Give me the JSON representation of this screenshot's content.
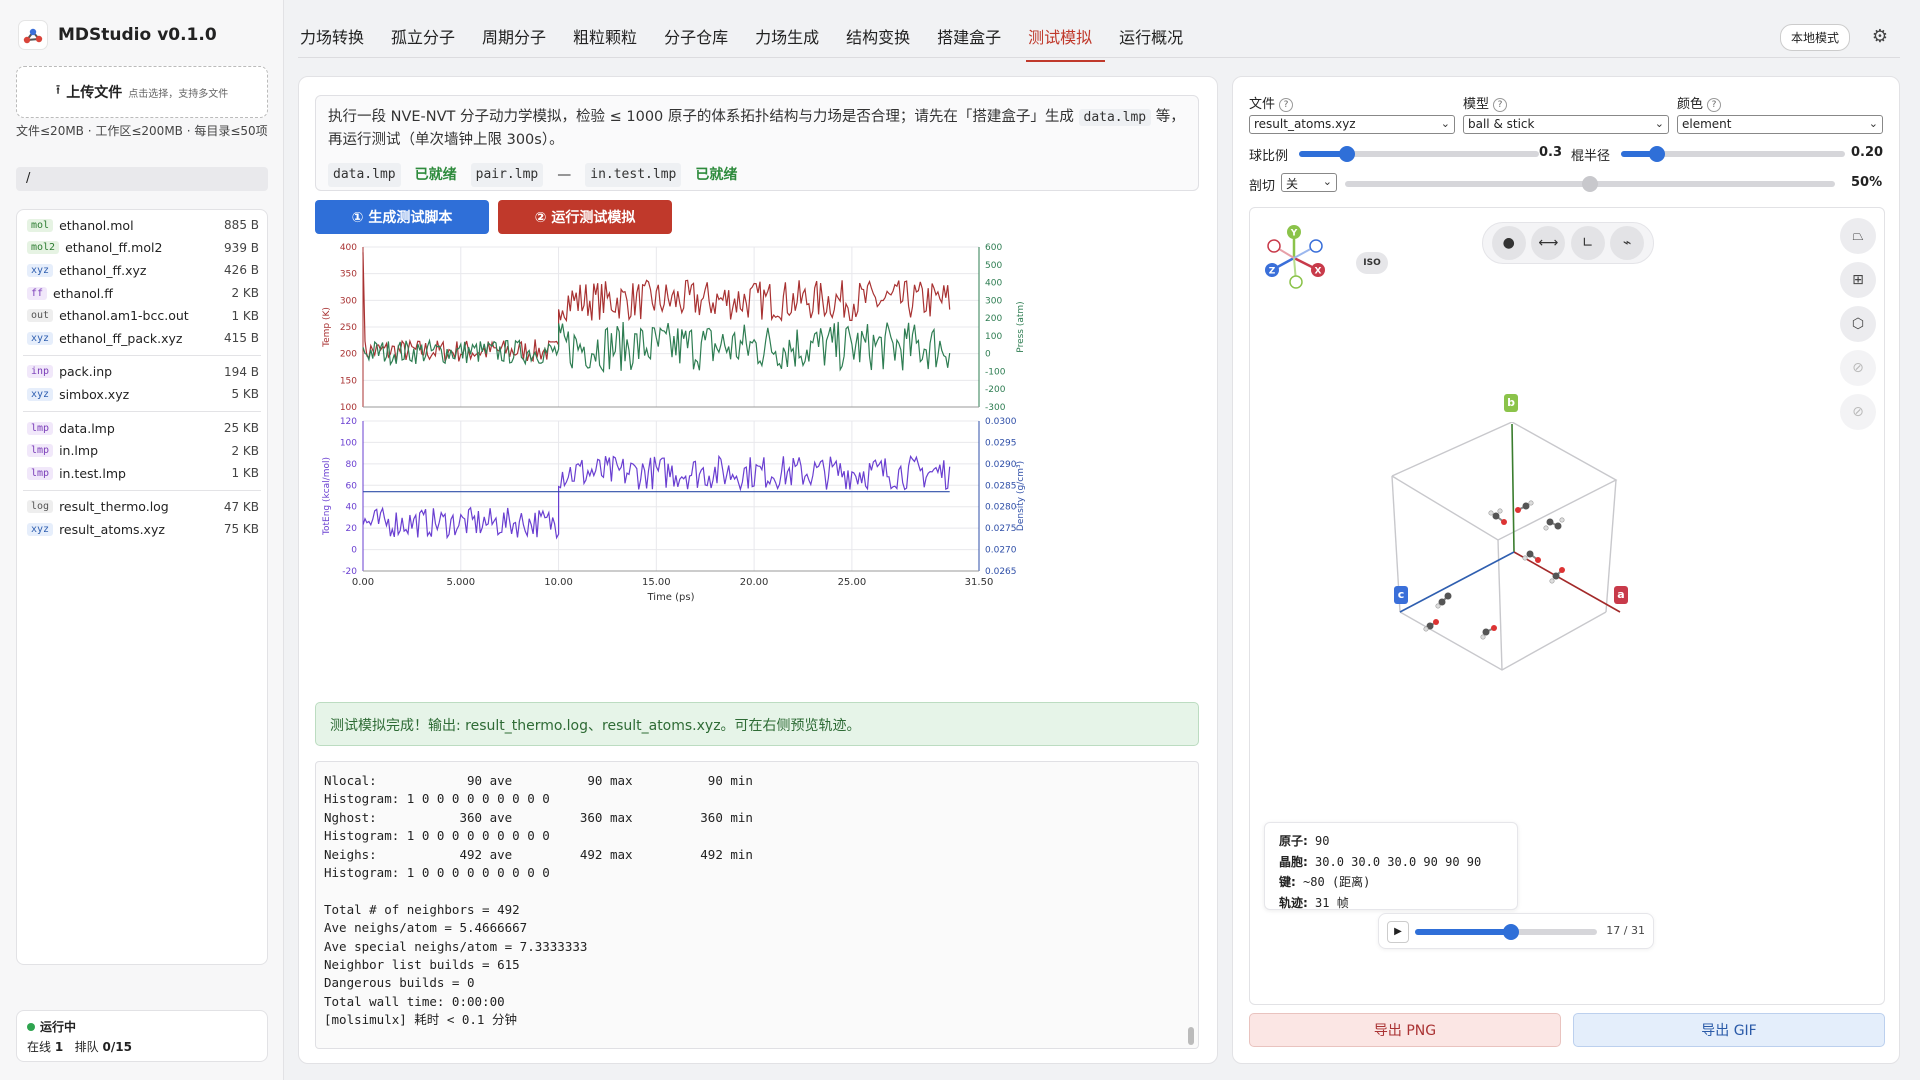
{
  "app": {
    "name": "MDStudio",
    "version": "v0.1.0"
  },
  "sidebar": {
    "upload_label": "上传文件",
    "upload_hint": "点击选择，支持多文件",
    "quota": "文件≤20MB · 工作区≤200MB · 每目录≤50项",
    "path": "/",
    "files": [
      {
        "ext": "mol",
        "name": "ethanol.mol",
        "size": "885 B",
        "bg": "#e6f3e3",
        "fg": "#2e7d32"
      },
      {
        "ext": "mol2",
        "name": "ethanol_ff.mol2",
        "size": "939 B",
        "bg": "#e6f3e3",
        "fg": "#2e7d32"
      },
      {
        "ext": "xyz",
        "name": "ethanol_ff.xyz",
        "size": "426 B",
        "bg": "#e6eefb",
        "fg": "#2f5fb0"
      },
      {
        "ext": "ff",
        "name": "ethanol.ff",
        "size": "2 KB",
        "bg": "#f1e8fa",
        "fg": "#7a3db8"
      },
      {
        "ext": "out",
        "name": "ethanol.am1-bcc.out",
        "size": "1 KB",
        "bg": "#eeeeee",
        "fg": "#555555"
      },
      {
        "ext": "xyz",
        "name": "ethanol_ff_pack.xyz",
        "size": "415 B",
        "bg": "#e6eefb",
        "fg": "#2f5fb0"
      },
      {
        "sep": true
      },
      {
        "ext": "inp",
        "name": "pack.inp",
        "size": "194 B",
        "bg": "#f1e8fa",
        "fg": "#7a3db8"
      },
      {
        "ext": "xyz",
        "name": "simbox.xyz",
        "size": "5 KB",
        "bg": "#e6eefb",
        "fg": "#2f5fb0"
      },
      {
        "sep": true
      },
      {
        "ext": "lmp",
        "name": "data.lmp",
        "size": "25 KB",
        "bg": "#f1e8fa",
        "fg": "#7a3db8"
      },
      {
        "ext": "lmp",
        "name": "in.lmp",
        "size": "2 KB",
        "bg": "#f1e8fa",
        "fg": "#7a3db8"
      },
      {
        "ext": "lmp",
        "name": "in.test.lmp",
        "size": "1 KB",
        "bg": "#f1e8fa",
        "fg": "#7a3db8"
      },
      {
        "sep": true
      },
      {
        "ext": "log",
        "name": "result_thermo.log",
        "size": "47 KB",
        "bg": "#eeeeee",
        "fg": "#555555"
      },
      {
        "ext": "xyz",
        "name": "result_atoms.xyz",
        "size": "75 KB",
        "bg": "#e6eefb",
        "fg": "#2f5fb0"
      }
    ],
    "status_title": "运行中",
    "status_online_label": "在线",
    "status_online": "1",
    "status_queue_label": "排队",
    "status_queue": "0/15"
  },
  "nav": {
    "tabs": [
      "力场转换",
      "孤立分子",
      "周期分子",
      "粗粒颗粒",
      "分子仓库",
      "力场生成",
      "结构变换",
      "搭建盒子",
      "测试模拟",
      "运行概况"
    ],
    "active": 8,
    "mode": "本地模式"
  },
  "test": {
    "description_1": "执行一段 NVE-NVT 分子动力学模拟，检验 ≤ 1000 原子的体系拓扑结构与力场是否合理；请先在「搭建盒子」生成 ",
    "description_code": "data.lmp",
    "description_2": " 等，再运行测试（单次墙钟上限 300s）。",
    "files": [
      {
        "name": "data.lmp",
        "state": "已就绪"
      },
      {
        "name": "pair.lmp",
        "state": "—"
      },
      {
        "name": "in.test.lmp",
        "state": "已就绪"
      }
    ],
    "btn_generate": "① 生成测试脚本",
    "btn_run": "② 运行测试模拟",
    "done_msg": "测试模拟完成！输出: result_thermo.log、result_atoms.xyz。可在右侧预览轨迹。",
    "log": "Nlocal:            90 ave          90 max          90 min\nHistogram: 1 0 0 0 0 0 0 0 0 0\nNghost:           360 ave         360 max         360 min\nHistogram: 1 0 0 0 0 0 0 0 0 0\nNeighs:           492 ave         492 max         492 min\nHistogram: 1 0 0 0 0 0 0 0 0 0\n\nTotal # of neighbors = 492\nAve neighs/atom = 5.4666667\nAve special neighs/atom = 7.3333333\nNeighbor list builds = 615\nDangerous builds = 0\nTotal wall time: 0:00:00\n[molsimulx] 耗时 < 0.1 分钟"
  },
  "chart_data": [
    {
      "type": "line",
      "xlim": [
        0,
        31.5
      ],
      "x_ticks": [
        "0.00",
        "5.000",
        "10.00",
        "15.00",
        "20.00",
        "25.00",
        "31.50"
      ],
      "ylabel": "Temp (K)",
      "ylim": [
        100,
        400
      ],
      "y_ticks": [
        100,
        150,
        200,
        250,
        300,
        350,
        400
      ],
      "y2label": "Press (atm)",
      "y2lim": [
        -300,
        600
      ],
      "y2_ticks": [
        -300,
        -200,
        -100,
        0,
        100,
        200,
        300,
        400,
        500,
        600
      ],
      "series": [
        {
          "color": "#a83232",
          "axis": "left",
          "segments": [
            {
              "x0": 0,
              "x1": 10,
              "mean": 205,
              "amp": 22,
              "start": 390
            },
            {
              "x0": 10,
              "x1": 30,
              "mean": 300,
              "amp": 38
            }
          ]
        },
        {
          "color": "#2e7d52",
          "axis": "right",
          "segments": [
            {
              "x0": 0,
              "x1": 10,
              "mean": 10,
              "amp": 70
            },
            {
              "x0": 10,
              "x1": 30,
              "mean": 40,
              "amp": 140
            }
          ]
        }
      ],
      "grid": true
    },
    {
      "type": "line",
      "xlabel": "Time (ps)",
      "xlim": [
        0,
        31.5
      ],
      "x_ticks": [
        "0.00",
        "5.000",
        "10.00",
        "15.00",
        "20.00",
        "25.00",
        "31.50"
      ],
      "ylabel": "TotEng (kcal/mol)",
      "ylim": [
        -20,
        120
      ],
      "y_ticks": [
        -20,
        0,
        20,
        40,
        60,
        80,
        100,
        120
      ],
      "y2label": "Density (g/cm³)",
      "y2lim": [
        0.0265,
        0.03
      ],
      "y2_ticks": [
        "0.0265",
        "0.0270",
        "0.0275",
        "0.0280",
        "0.0285",
        "0.0290",
        "0.0295",
        "0.0300"
      ],
      "series": [
        {
          "color": "#6a3fd1",
          "axis": "left",
          "segments": [
            {
              "x0": 0,
              "x1": 10,
              "mean": 25,
              "amp": 14
            },
            {
              "x0": 10,
              "x1": 30,
              "mean": 72,
              "amp": 16
            }
          ]
        },
        {
          "color": "#2f4fa8",
          "axis": "right",
          "constant": 0.02835
        }
      ],
      "grid": true
    }
  ],
  "viewer": {
    "file_label": "文件",
    "file_value": "result_atoms.xyz",
    "model_label": "模型",
    "model_value": "ball & stick",
    "color_label": "颜色",
    "color_value": "element",
    "ball_label": "球比例",
    "ball_value": "0.3",
    "ball_fraction": 0.2,
    "rod_label": "棍半径",
    "rod_value": "0.20",
    "rod_fraction": 0.16,
    "clip_label": "剖切",
    "clip_value": "关",
    "clip_pct": "50%",
    "clip_fraction": 0.5,
    "iso_label": "ISO",
    "axes": {
      "y": "Y",
      "z": "Z",
      "x": "X"
    },
    "cell_labels": {
      "a": "a",
      "b": "b",
      "c": "c"
    },
    "info": {
      "atoms_label": "原子:",
      "atoms": "90",
      "cell_label": "晶胞:",
      "cell": "30.0 30.0 30.0 90 90 90",
      "bonds_label": "键:",
      "bonds": "~80 (距离)",
      "traj_label": "轨迹:",
      "traj": "31 帧"
    },
    "frame": "17 / 31",
    "frame_fraction": 0.53,
    "export_png": "导出 PNG",
    "export_gif": "导出 GIF"
  }
}
